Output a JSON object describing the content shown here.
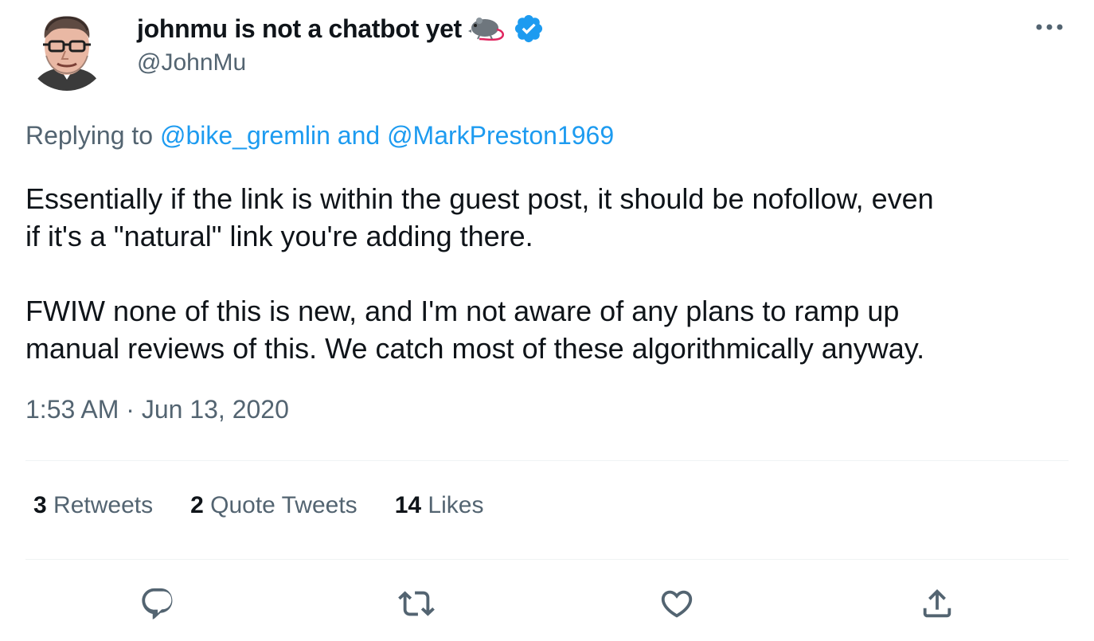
{
  "author": {
    "display_name": "johnmu is not a chatbot yet",
    "name_emoji_icon": "rat-icon",
    "verified_icon": "verified-badge-icon",
    "handle": "@JohnMu"
  },
  "more_icon": "more-horizontal-icon",
  "replying": {
    "prefix": "Replying to",
    "user1": "@bike_gremlin",
    "conjunction": "and",
    "user2": "@MarkPreston1969"
  },
  "tweet": {
    "paragraph1": "Essentially if the link is within the guest post, it should be nofollow, even\nif it's a \"natural\" link you're adding there.",
    "paragraph2": "FWIW none of this is new, and I'm not aware of any plans to ramp up\nmanual reviews of this. We catch most of these algorithmically anyway."
  },
  "timestamp": {
    "time": "1:53 AM",
    "separator": "·",
    "date": "Jun 13, 2020"
  },
  "stats": {
    "retweets_count": "3",
    "retweets_label": "Retweets",
    "quotes_count": "2",
    "quotes_label": "Quote Tweets",
    "likes_count": "14",
    "likes_label": "Likes"
  },
  "actions": [
    "reply-icon",
    "retweet-icon",
    "like-icon",
    "share-icon"
  ],
  "colors": {
    "text_primary": "#0f1419",
    "text_secondary": "#536471",
    "link": "#1d9bf0",
    "divider": "#eff3f4"
  }
}
